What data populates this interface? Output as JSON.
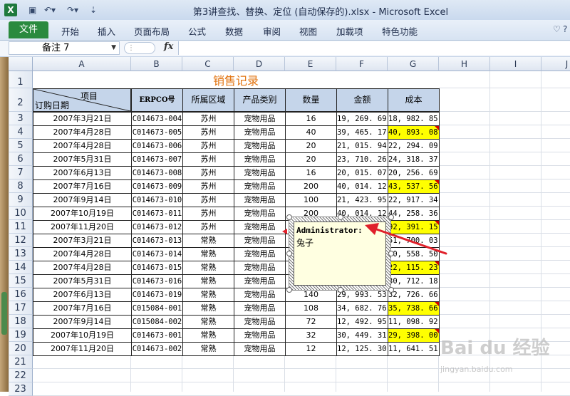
{
  "window": {
    "title": "第3讲查找、替换、定位 (自动保存的).xlsx - Microsoft Excel",
    "app_icon": "X"
  },
  "ribbon": {
    "file": "文件",
    "tabs": [
      "开始",
      "插入",
      "页面布局",
      "公式",
      "数据",
      "审阅",
      "视图",
      "加载项",
      "特色功能"
    ]
  },
  "formula_bar": {
    "name_box": "备注 7",
    "fx": "fx",
    "value": ""
  },
  "columns": [
    "A",
    "B",
    "C",
    "D",
    "E",
    "F",
    "G",
    "H",
    "I",
    "J"
  ],
  "rows": [
    "1",
    "2",
    "3",
    "4",
    "5",
    "6",
    "7",
    "8",
    "9",
    "10",
    "11",
    "12",
    "13",
    "14",
    "15",
    "16",
    "17",
    "18",
    "19",
    "20",
    "21",
    "22",
    "23"
  ],
  "sheet": {
    "title": "销售记录",
    "diag_top": "项目",
    "diag_bottom": "订购日期",
    "headers": [
      "ERPCO号",
      "所属区域",
      "产品类别",
      "数量",
      "金额",
      "成本"
    ],
    "data": [
      [
        "2007年3月21日",
        "C014673-004",
        "苏州",
        "宠物用品",
        "16",
        "19, 269. 69",
        "18, 982. 85",
        false
      ],
      [
        "2007年4月28日",
        "C014673-005",
        "苏州",
        "宠物用品",
        "40",
        "39, 465. 17",
        "40, 893. 08",
        true
      ],
      [
        "2007年4月28日",
        "C014673-006",
        "苏州",
        "宠物用品",
        "20",
        "21, 015. 94",
        "22, 294. 09",
        false
      ],
      [
        "2007年5月31日",
        "C014673-007",
        "苏州",
        "宠物用品",
        "20",
        "23, 710. 26",
        "24, 318. 37",
        false
      ],
      [
        "2007年6月13日",
        "C014673-008",
        "苏州",
        "宠物用品",
        "16",
        "20, 015. 07",
        "20, 256. 69",
        false
      ],
      [
        "2007年7月16日",
        "C014673-009",
        "苏州",
        "宠物用品",
        "200",
        "40, 014. 12",
        "43, 537. 56",
        true
      ],
      [
        "2007年9月14日",
        "C014673-010",
        "苏州",
        "宠物用品",
        "100",
        "21, 423. 95",
        "22, 917. 34",
        false
      ],
      [
        "2007年10月19日",
        "C014673-011",
        "苏州",
        "宠物用品",
        "200",
        "40, 014. 12",
        "44, 258. 36",
        false
      ],
      [
        "2007年11月20日",
        "C014673-012",
        "苏州",
        "宠物用品",
        "",
        "",
        "92, 391. 15",
        true
      ],
      [
        "2007年3月21日",
        "C014673-013",
        "常熟",
        "宠物用品",
        "",
        "",
        "51, 700. 03",
        false
      ],
      [
        "2007年4月28日",
        "C014673-014",
        "常熟",
        "宠物用品",
        "",
        "",
        "50, 558. 50",
        false
      ],
      [
        "2007年4月28日",
        "C014673-015",
        "常熟",
        "宠物用品",
        "",
        "",
        "22, 115. 23",
        true
      ],
      [
        "2007年5月31日",
        "C014673-016",
        "常熟",
        "宠物用品",
        "",
        "",
        "30, 712. 18",
        false
      ],
      [
        "2007年6月13日",
        "C014673-019",
        "常熟",
        "宠物用品",
        "140",
        "29, 993. 53",
        "32, 726. 66",
        false
      ],
      [
        "2007年7月16日",
        "C015084-001",
        "常熟",
        "宠物用品",
        "108",
        "34, 682. 76",
        "35, 738. 66",
        true
      ],
      [
        "2007年9月14日",
        "C015084-002",
        "常熟",
        "宠物用品",
        "72",
        "12, 492. 95",
        "11, 098. 92",
        false
      ],
      [
        "2007年10月19日",
        "C014673-001",
        "常熟",
        "宠物用品",
        "32",
        "30, 449. 31",
        "29, 398. 00",
        true
      ],
      [
        "2007年11月20日",
        "C014673-002",
        "常熟",
        "宠物用品",
        "12",
        "12, 125. 30",
        "11, 641. 51",
        false
      ]
    ]
  },
  "comment": {
    "author": "Administrator:",
    "text": "兔子"
  },
  "watermark": {
    "logo": "Bai du 经验",
    "url": "jingyan.baidu.com"
  },
  "colors": {
    "title_orange": "#e2730f",
    "header_blue": "#c5d5ea",
    "highlight_yellow": "#ffff00",
    "comment_yellow": "#ffffe1",
    "arrow_red": "#e0202a",
    "file_tab_green": "#2a8a3e"
  }
}
